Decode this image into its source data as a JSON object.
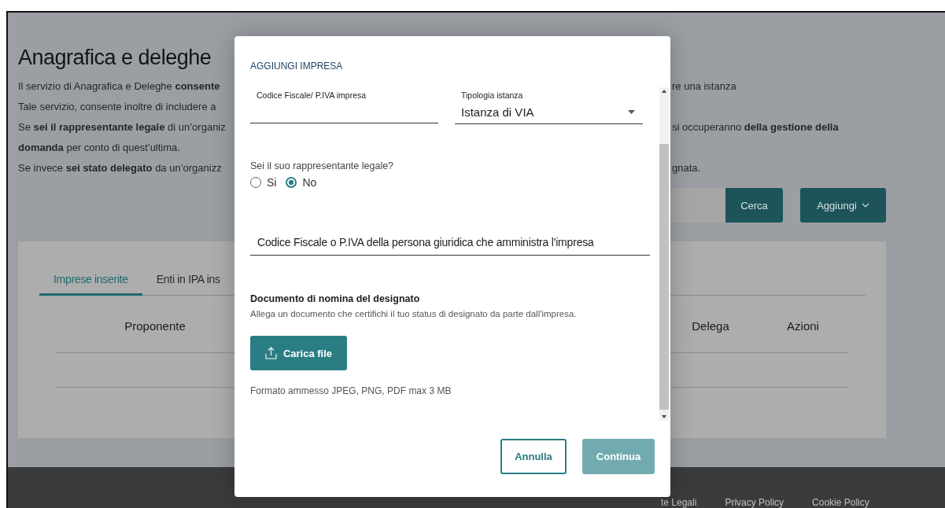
{
  "page": {
    "title": "Anagrafica e deleghe",
    "intro_lines": [
      {
        "left": "Il servizio di Anagrafica e Deleghe **consente**",
        "right": "re una istanza"
      },
      {
        "left": "Tale servizio, consente inoltre di includere a"
      },
      {
        "left": "Se **sei il rappresentante legale** di un’organiz",
        "right": "si occuperanno **della gestione della**"
      },
      {
        "left": "**domanda** per conto di quest’ultima."
      },
      {
        "left": "Se invece **sei stato delegato** da un’organizz",
        "right": "gnata."
      }
    ],
    "search_button": "Cerca",
    "add_button": "Aggiungi",
    "tabs": [
      {
        "label": "Imprese inserite",
        "selected": true
      },
      {
        "label": "Enti in IPA ins",
        "selected": false
      }
    ],
    "table": {
      "columns": [
        {
          "label": "Proponente"
        },
        {
          "label": "Delega"
        },
        {
          "label": "Azioni"
        }
      ]
    }
  },
  "footer": {
    "links": [
      "te Legali",
      "Privacy Policy",
      "Cookie Policy"
    ]
  },
  "modal": {
    "title": "AGGIUNGI IMPRESA",
    "company_id": {
      "label": "Codice Fiscale/ P.IVA impresa"
    },
    "request_type": {
      "label": "Tipologia istanza",
      "value": "Istanza di VIA"
    },
    "legal_rep": {
      "question": "Sei il suo rappresentante legale?",
      "options": [
        {
          "label": "Si",
          "selected": false
        },
        {
          "label": "No",
          "selected": true
        }
      ]
    },
    "admin_id": {
      "placeholder": "Codice Fiscale o P.IVA della persona giuridica che amministra l'impresa"
    },
    "document": {
      "title": "Documento di nomina del designato",
      "description": "Allega un documento che certifichi il tuo status di designato da parte dall'impresa.",
      "upload_button": "Carica file",
      "hint": "Formato ammesso JPEG, PNG, PDF max 3 MB"
    },
    "buttons": [
      {
        "label": "Annulla",
        "kind": "outline",
        "disabled": false
      },
      {
        "label": "Continua",
        "kind": "primary",
        "disabled": true
      }
    ]
  }
}
